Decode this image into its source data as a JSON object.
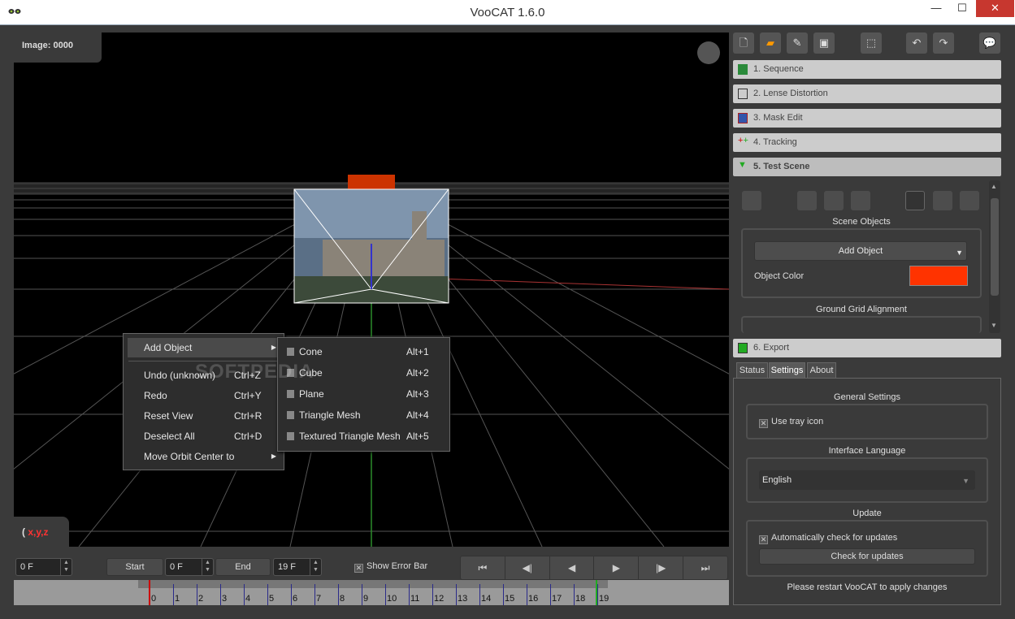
{
  "window": {
    "title": "VooCAT 1.6.0",
    "min": "—",
    "max": "☐",
    "close": "✕"
  },
  "viewport": {
    "image_label": "Image: 0000",
    "axis_label": "x,y,z",
    "axis_open": "(",
    "object_color": "#ff3300"
  },
  "context_menu": {
    "items": [
      {
        "label": "Add Object",
        "shortcut": "",
        "arrow": "▶"
      },
      {
        "label": "Undo (unknown)",
        "shortcut": "Ctrl+Z"
      },
      {
        "label": "Redo",
        "shortcut": "Ctrl+Y"
      },
      {
        "label": "Reset View",
        "shortcut": "Ctrl+R"
      },
      {
        "label": "Deselect All",
        "shortcut": "Ctrl+D"
      },
      {
        "label": "Move Orbit Center to",
        "shortcut": "",
        "arrow": "▶"
      }
    ]
  },
  "submenu": {
    "items": [
      {
        "label": "Cone",
        "shortcut": "Alt+1"
      },
      {
        "label": "Cube",
        "shortcut": "Alt+2"
      },
      {
        "label": "Plane",
        "shortcut": "Alt+3"
      },
      {
        "label": "Triangle Mesh",
        "shortcut": "Alt+4"
      },
      {
        "label": "Textured Triangle Mesh",
        "shortcut": "Alt+5"
      }
    ]
  },
  "watermark": "SOFTPEDIA",
  "bottom": {
    "current_frame": "0 F",
    "start_label": "Start",
    "start_value": "0 F",
    "end_label": "End",
    "end_value": "19 F",
    "show_error_bar": "Show Error Bar",
    "transport": [
      "⏮",
      "◀|",
      "◀",
      "▶",
      "|▶",
      "⏭"
    ]
  },
  "timeline": {
    "ticks": [
      "0",
      "1",
      "2",
      "3",
      "4",
      "5",
      "6",
      "7",
      "8",
      "9",
      "10",
      "11",
      "12",
      "13",
      "14",
      "15",
      "16",
      "17",
      "18",
      "19"
    ]
  },
  "sections": [
    {
      "label": "1. Sequence"
    },
    {
      "label": "2. Lense Distortion"
    },
    {
      "label": "3. Mask Edit"
    },
    {
      "label": "4. Tracking"
    },
    {
      "label": "5. Test Scene"
    },
    {
      "label": "6. Export"
    }
  ],
  "test_scene": {
    "scene_objects": "Scene Objects",
    "add_object": "Add Object",
    "object_color_label": "Object Color",
    "ground_grid": "Ground Grid Alignment"
  },
  "tabs": [
    "Status",
    "Settings",
    "About"
  ],
  "settings": {
    "general": "General Settings",
    "use_tray": "Use tray icon",
    "interface_language": "Interface Language",
    "language": "English",
    "update": "Update",
    "auto_check": "Automatically check for updates",
    "check_button": "Check for updates",
    "restart_note": "Please restart VooCAT to apply changes"
  }
}
